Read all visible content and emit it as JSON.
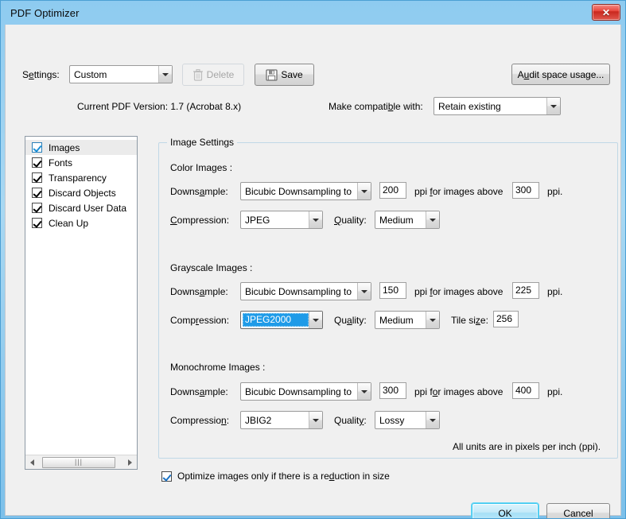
{
  "window": {
    "title": "PDF Optimizer",
    "close_glyph": "✕"
  },
  "toolbar": {
    "settings_label_pre": "S",
    "settings_label_accel": "e",
    "settings_label_post": "ttings:",
    "settings_value": "Custom",
    "delete_label": "Delete",
    "save_label": "Save",
    "audit_label_pre": "A",
    "audit_label_accel": "u",
    "audit_label_post": "dit space usage...",
    "version_text": "Current PDF Version: 1.7 (Acrobat 8.x)",
    "compatible_label_pre": "Make compati",
    "compatible_label_accel": "b",
    "compatible_label_post": "le with:",
    "compatible_value": "Retain existing"
  },
  "panel_list": {
    "items": [
      {
        "label": "Images",
        "checked": true,
        "selected": true
      },
      {
        "label": "Fonts",
        "checked": true,
        "selected": false
      },
      {
        "label": "Transparency",
        "checked": true,
        "selected": false
      },
      {
        "label": "Discard Objects",
        "checked": true,
        "selected": false
      },
      {
        "label": "Discard User Data",
        "checked": true,
        "selected": false
      },
      {
        "label": "Clean Up",
        "checked": true,
        "selected": false
      }
    ]
  },
  "image_settings": {
    "group_title": "Image Settings",
    "units_note": "All units are in pixels per inch (ppi).",
    "labels": {
      "downsample_pre": "Downs",
      "downsample_accel": "a",
      "downsample_post": "mple:",
      "compression_pre": "",
      "compression_accel": "C",
      "compression_post": "ompression:",
      "compression2_pre": "Comp",
      "compression2_accel": "r",
      "compression2_post": "ession:",
      "compression3_pre": "Compressio",
      "compression3_accel": "n",
      "compression3_post": ":",
      "quality_pre": "",
      "quality_accel": "Q",
      "quality_post": "uality:",
      "quality2_pre": "Qu",
      "quality2_accel": "a",
      "quality2_post": "lity:",
      "quality3_pre": "Qualit",
      "quality3_accel": "y",
      "quality3_post": ":",
      "ppi_above_pre": "ppi ",
      "ppi_above_accel": "f",
      "ppi_above_post": "or images above",
      "ppi_above2_pre": "ppi f",
      "ppi_above2_accel": "o",
      "ppi_above2_post": "r images above",
      "ppi_suffix": "ppi.",
      "tile_size_pre": "Tile si",
      "tile_size_accel": "z",
      "tile_size_post": "e:"
    },
    "color": {
      "section": "Color Images :",
      "downsample_method": "Bicubic Downsampling to",
      "downsample_ppi": "200",
      "threshold_ppi": "300",
      "compression": "JPEG",
      "quality": "Medium"
    },
    "grayscale": {
      "section": "Grayscale Images :",
      "downsample_method": "Bicubic Downsampling to",
      "downsample_ppi": "150",
      "threshold_ppi": "225",
      "compression": "JPEG2000",
      "compression_focused": true,
      "quality": "Medium",
      "tile_size": "256"
    },
    "monochrome": {
      "section": "Monochrome Images :",
      "downsample_method": "Bicubic Downsampling to",
      "downsample_ppi": "300",
      "threshold_ppi": "400",
      "compression": "JBIG2",
      "quality": "Lossy"
    }
  },
  "footer": {
    "optimize_pre": "Optimize images only if there is a re",
    "optimize_accel": "d",
    "optimize_post": "uction in size",
    "optimize_checked": true,
    "ok_label": "OK",
    "cancel_label": "Cancel"
  },
  "colors": {
    "accent": "#1e9be8",
    "title_bar": "#8ecbf0",
    "close_red": "#e8463c",
    "dialog_bg": "#f0f0f0"
  }
}
